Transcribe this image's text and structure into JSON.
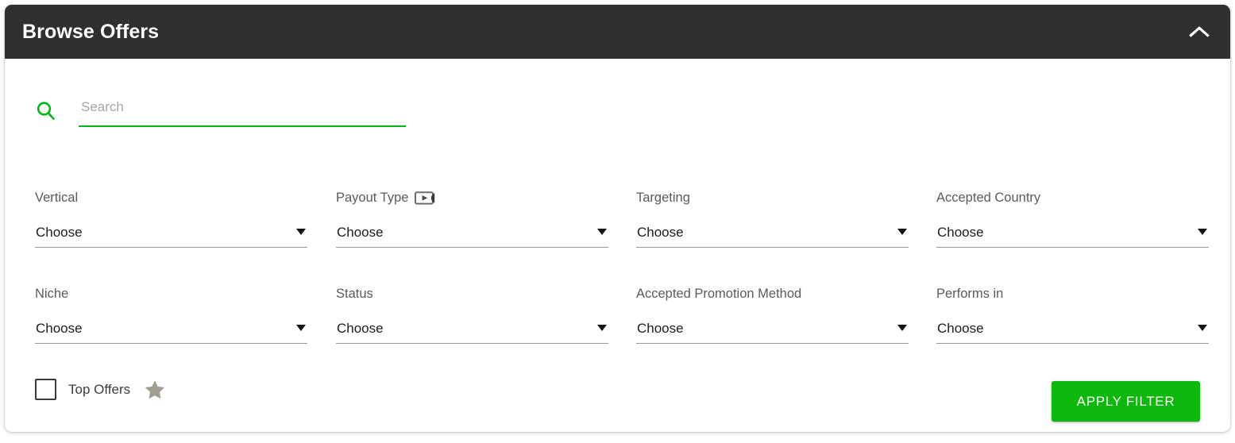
{
  "colors": {
    "header_bg": "#2f2f2f",
    "accent_green": "#00b812",
    "button_green": "#0cb80c",
    "label_gray": "#5b5b5b",
    "star_gray": "#a39e93"
  },
  "header": {
    "title": "Browse Offers",
    "collapse_icon": "chevron-up-icon"
  },
  "search": {
    "icon": "search-icon",
    "placeholder": "Search",
    "value": ""
  },
  "filters": [
    {
      "label": "Vertical",
      "value": "Choose",
      "icon": null,
      "column": 1,
      "row": 1
    },
    {
      "label": "Payout Type",
      "value": "Choose",
      "icon": "video-tutorial-icon",
      "column": 2,
      "row": 1
    },
    {
      "label": "Targeting",
      "value": "Choose",
      "icon": null,
      "column": 3,
      "row": 1
    },
    {
      "label": "Accepted Country",
      "value": "Choose",
      "icon": null,
      "column": 4,
      "row": 1
    },
    {
      "label": "Niche",
      "value": "Choose",
      "icon": null,
      "column": 1,
      "row": 2
    },
    {
      "label": "Status",
      "value": "Choose",
      "icon": null,
      "column": 2,
      "row": 2
    },
    {
      "label": "Accepted Promotion Method",
      "value": "Choose",
      "icon": null,
      "column": 3,
      "row": 2
    },
    {
      "label": "Performs in",
      "value": "Choose",
      "icon": null,
      "column": 4,
      "row": 2
    }
  ],
  "top_offers": {
    "label": "Top Offers",
    "checked": false,
    "icon": "star-icon"
  },
  "apply_button": {
    "label": "APPLY FILTER"
  }
}
